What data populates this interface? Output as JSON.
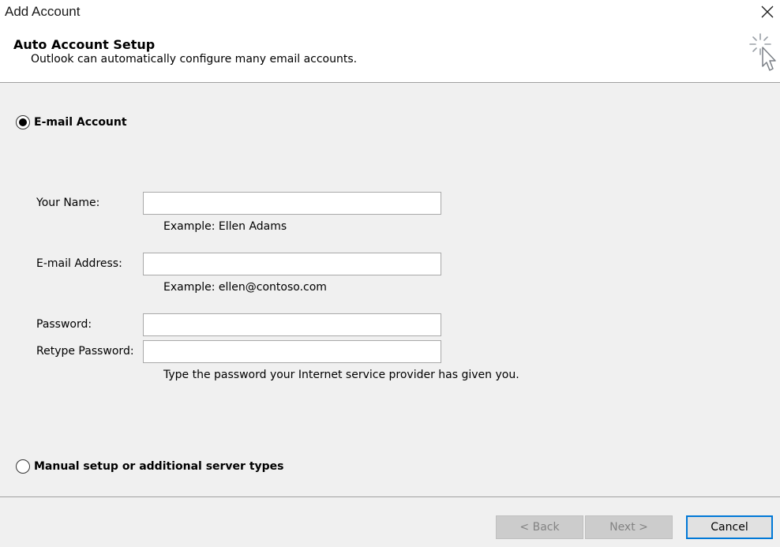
{
  "window": {
    "title": "Add Account",
    "close_label": "Close"
  },
  "header": {
    "heading": "Auto Account Setup",
    "subheading": "Outlook can automatically configure many email accounts.",
    "icon": "wizard-cursor-icon"
  },
  "email_account": {
    "label": "E-mail Account",
    "selected": true
  },
  "form": {
    "name": {
      "label": "Your Name:",
      "value": "",
      "hint": "Example: Ellen Adams"
    },
    "email": {
      "label": "E-mail Address:",
      "value": "",
      "hint": "Example: ellen@contoso.com"
    },
    "password": {
      "label": "Password:",
      "value": ""
    },
    "retype_password": {
      "label": "Retype Password:",
      "value": "",
      "hint": "Type the password your Internet service provider has given you."
    }
  },
  "manual_setup": {
    "label": "Manual setup or additional server types",
    "selected": false
  },
  "buttons": {
    "back": "< Back",
    "next": "Next >",
    "cancel": "Cancel"
  },
  "colors": {
    "header_background": "#ffffff",
    "dialog_background": "#f0f0f0",
    "default_button_border": "#0078d7",
    "disabled_button_background": "#cccccc",
    "disabled_button_text": "#838383"
  }
}
